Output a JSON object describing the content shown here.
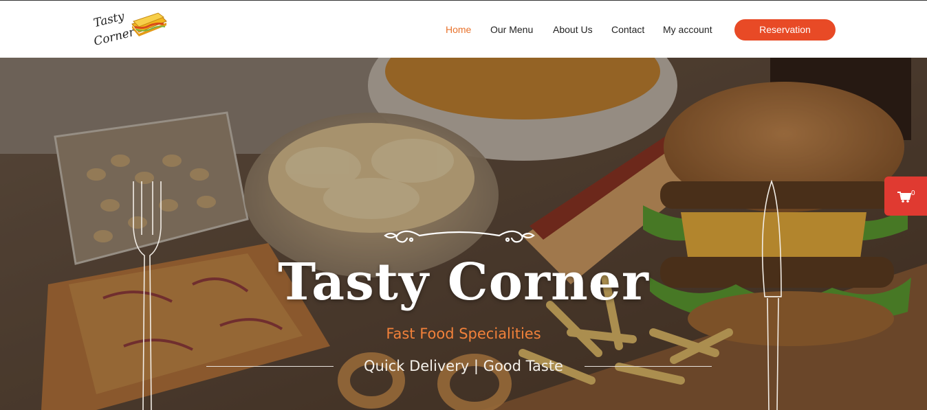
{
  "logo": {
    "line1": "Tasty",
    "line2": "Corner",
    "icon": "sandwich-logo-icon"
  },
  "nav": {
    "items": [
      {
        "label": "Home",
        "active": true
      },
      {
        "label": "Our Menu",
        "active": false
      },
      {
        "label": "About Us",
        "active": false
      },
      {
        "label": "Contact",
        "active": false
      },
      {
        "label": "My account",
        "active": false
      }
    ],
    "reservation_label": "Reservation"
  },
  "hero": {
    "title": "Tasty Corner",
    "subtitle": "Fast Food Specialities",
    "tagline": "Quick Delivery | Good Taste"
  },
  "cart": {
    "count": "0",
    "icon": "shopping-cart-icon"
  },
  "colors": {
    "accent_orange": "#e8722b",
    "reservation_red": "#e84a26",
    "cart_red": "#e03a31",
    "subtitle_orange": "#f2813a"
  }
}
